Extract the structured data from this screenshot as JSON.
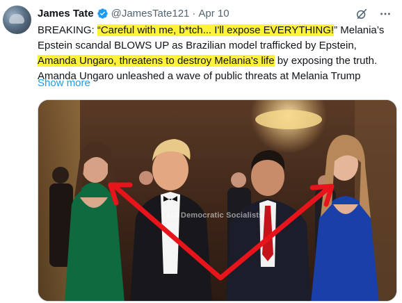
{
  "user": {
    "name": "James Tate",
    "handle": "@JamesTate121",
    "separator": "·",
    "date": "Apr 10",
    "verified": true
  },
  "icons": {
    "verified": "verified-badge-icon",
    "grok": "grok-icon",
    "more": "more-icon"
  },
  "tweet": {
    "line1": {
      "a": "BREAKING: ",
      "b": "“Careful with me, b*tch... I'll expose EVERYTHING!",
      "c": "” Melania’s"
    },
    "line2": "Epstein scandal BLOWS UP as Brazilian model trafficked by Epstein,",
    "line3": {
      "a": "Amanda Ungaro, threatens to destroy Melania's life",
      "b": " by exposing the truth."
    },
    "line4": "Amanda Ungaro unleashed a wave of public threats at Melania Trump",
    "show_more": "Show more"
  },
  "media": {
    "watermark": "US Democratic Socialists",
    "arrow_color": "#e8141b",
    "highlight_color": "#fff23a"
  },
  "colors": {
    "link": "#1d9bf0",
    "muted": "#536471",
    "verified": "#1d9bf0"
  }
}
